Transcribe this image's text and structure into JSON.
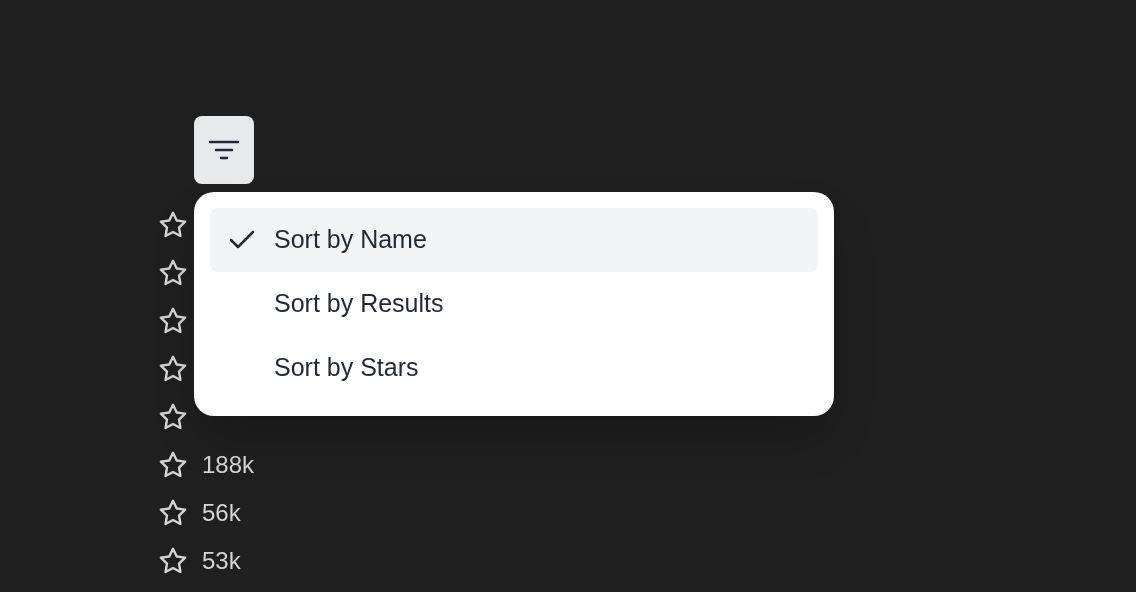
{
  "filter_button": {
    "kind": "filter"
  },
  "menu": {
    "items": [
      {
        "label": "Sort by Name",
        "selected": true
      },
      {
        "label": "Sort by Results",
        "selected": false
      },
      {
        "label": "Sort by Stars",
        "selected": false
      }
    ]
  },
  "rows": [
    {
      "kind": "covered"
    },
    {
      "kind": "covered"
    },
    {
      "kind": "covered"
    },
    {
      "kind": "covered"
    },
    {
      "kind": "covered"
    },
    {
      "kind": "count",
      "count": "188k"
    },
    {
      "kind": "count",
      "count": "56k"
    },
    {
      "kind": "count",
      "count": "53k"
    }
  ]
}
